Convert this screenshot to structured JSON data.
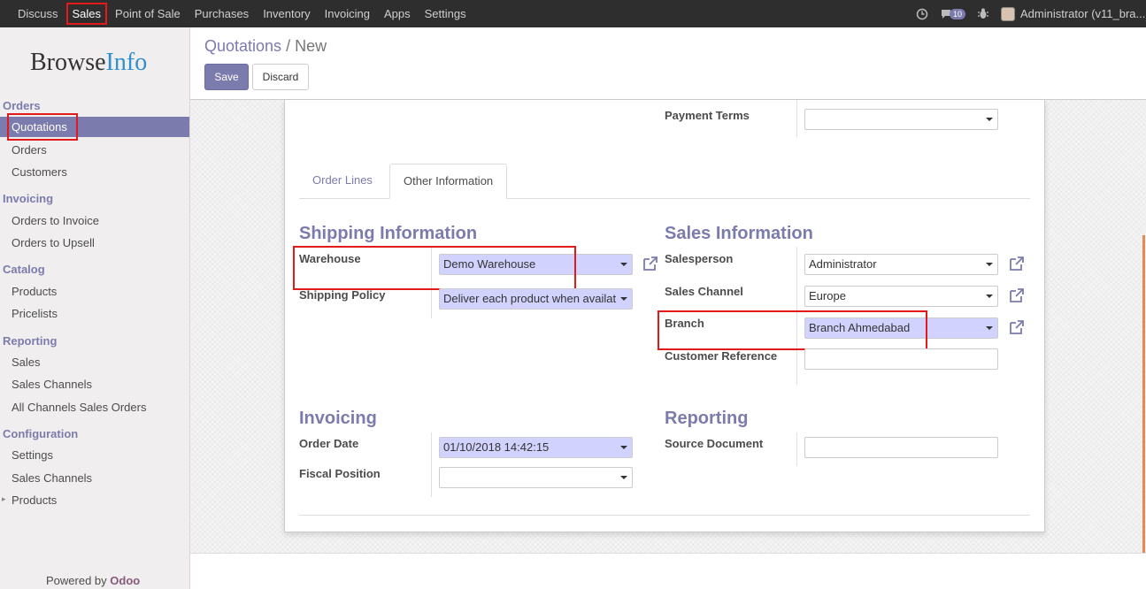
{
  "topbar": {
    "menu": [
      "Discuss",
      "Sales",
      "Point of Sale",
      "Purchases",
      "Inventory",
      "Invoicing",
      "Apps",
      "Settings"
    ],
    "message_count": "10",
    "user": "Administrator (v11_bra..."
  },
  "sidebar": {
    "logo_browse": "Browse",
    "logo_info": "Info",
    "sections": {
      "orders": "Orders",
      "invoicing": "Invoicing",
      "catalog": "Catalog",
      "reporting": "Reporting",
      "configuration": "Configuration"
    },
    "items": {
      "quotations": "Quotations",
      "orders": "Orders",
      "customers": "Customers",
      "orders_to_invoice": "Orders to Invoice",
      "orders_to_upsell": "Orders to Upsell",
      "products": "Products",
      "pricelists": "Pricelists",
      "sales": "Sales",
      "sales_channels": "Sales Channels",
      "all_channels_sales_orders": "All Channels Sales Orders",
      "settings": "Settings",
      "config_sales_channels": "Sales Channels",
      "config_products": "Products"
    },
    "powered_by": "Powered by",
    "odoo": "Odoo"
  },
  "breadcrumb": {
    "parent": "Quotations",
    "separator": "/",
    "current": "New"
  },
  "actions": {
    "save": "Save",
    "discard": "Discard"
  },
  "form": {
    "payment_terms_label": "Payment Terms",
    "tabs": [
      "Order Lines",
      "Other Information"
    ],
    "shipping": {
      "title": "Shipping Information",
      "warehouse_label": "Warehouse",
      "warehouse_value": "Demo Warehouse",
      "shipping_policy_label": "Shipping Policy",
      "shipping_policy_value": "Deliver each product when availat"
    },
    "sales_info": {
      "title": "Sales Information",
      "salesperson_label": "Salesperson",
      "salesperson_value": "Administrator",
      "sales_channel_label": "Sales Channel",
      "sales_channel_value": "Europe",
      "branch_label": "Branch",
      "branch_value": "Branch Ahmedabad",
      "customer_reference_label": "Customer Reference"
    },
    "invoicing": {
      "title": "Invoicing",
      "order_date_label": "Order Date",
      "order_date_value": "01/10/2018 14:42:15",
      "fiscal_position_label": "Fiscal Position"
    },
    "reporting": {
      "title": "Reporting",
      "source_document_label": "Source Document"
    }
  },
  "colors": {
    "accent": "#7c7bad",
    "topbar": "#2e2e2e",
    "required_field": "#d2d2ff",
    "highlight": "#e21a1a"
  }
}
